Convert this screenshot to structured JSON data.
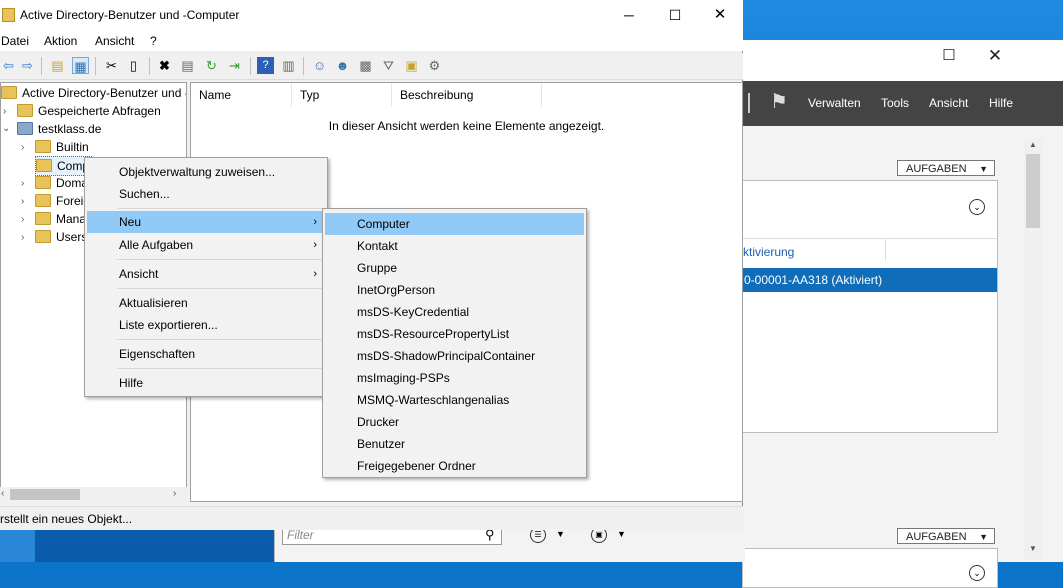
{
  "window": {
    "title": "Active Directory-Benutzer und -Computer",
    "minimize": "─",
    "maximize": "☐",
    "close": "✕"
  },
  "menubar": [
    "Datei",
    "Aktion",
    "Ansicht",
    "?"
  ],
  "tree": {
    "root": "Active Directory-Benutzer und -",
    "saved_queries": "Gespeicherte Abfragen",
    "domain": "testklass.de",
    "children": [
      "Builtin",
      "Comp",
      "Doma",
      "Foreig",
      "Mana",
      "Users"
    ]
  },
  "list": {
    "columns": [
      "Name",
      "Typ",
      "Beschreibung"
    ],
    "empty_message": "In dieser Ansicht werden keine Elemente angezeigt."
  },
  "status": "rstellt ein neues Objekt...",
  "context_menu": {
    "items": [
      "Objektverwaltung zuweisen...",
      "Suchen...",
      "Neu",
      "Alle Aufgaben",
      "Ansicht",
      "Aktualisieren",
      "Liste exportieren...",
      "Eigenschaften",
      "Hilfe"
    ],
    "highlighted": "Neu"
  },
  "submenu": {
    "items": [
      "Computer",
      "Kontakt",
      "Gruppe",
      "InetOrgPerson",
      "msDS-KeyCredential",
      "msDS-ResourcePropertyList",
      "msDS-ShadowPrincipalContainer",
      "msImaging-PSPs",
      "MSMQ-Warteschlangenalias",
      "Drucker",
      "Benutzer",
      "Freigegebener Ordner"
    ],
    "highlighted": "Computer"
  },
  "server_manager": {
    "menu": [
      "Verwalten",
      "Tools",
      "Ansicht",
      "Hilfe"
    ],
    "tasks_label": "AUFGABEN",
    "column_partial": "ktivierung",
    "selected_row": "0-00001-AA318 (Aktiviert)",
    "filter_placeholder": "Filter"
  },
  "colors": {
    "highlight": "#91c9f7",
    "selection": "#0f6db9",
    "sm_bar": "#444444"
  }
}
